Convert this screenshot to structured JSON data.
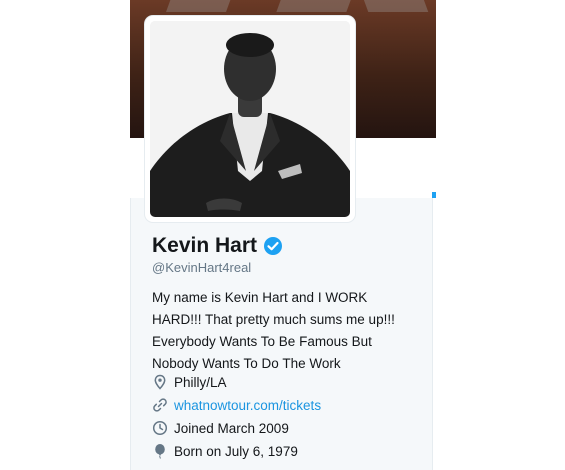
{
  "profile": {
    "name": "Kevin Hart",
    "handle": "@KevinHart4real",
    "bio_lines": [
      "My name is Kevin Hart and I WORK",
      "HARD!!! That pretty much sums me up!!!",
      "Everybody Wants To Be Famous But",
      "Nobody Wants To Do The Work"
    ],
    "location": "Philly/LA",
    "website": "whatnowtour.com/tickets",
    "joined": "Joined March 2009",
    "birthday": "Born on July 6, 1979"
  },
  "icons": {
    "verified": "verified-badge-icon",
    "location": "location-pin-icon",
    "website": "link-icon",
    "joined": "calendar-clock-icon",
    "birthday": "balloon-icon"
  },
  "colors": {
    "accent": "#1da1f2",
    "link": "#1b95e0",
    "text": "#14171a",
    "muted": "#657786",
    "card_bg": "#f5f8fa"
  }
}
